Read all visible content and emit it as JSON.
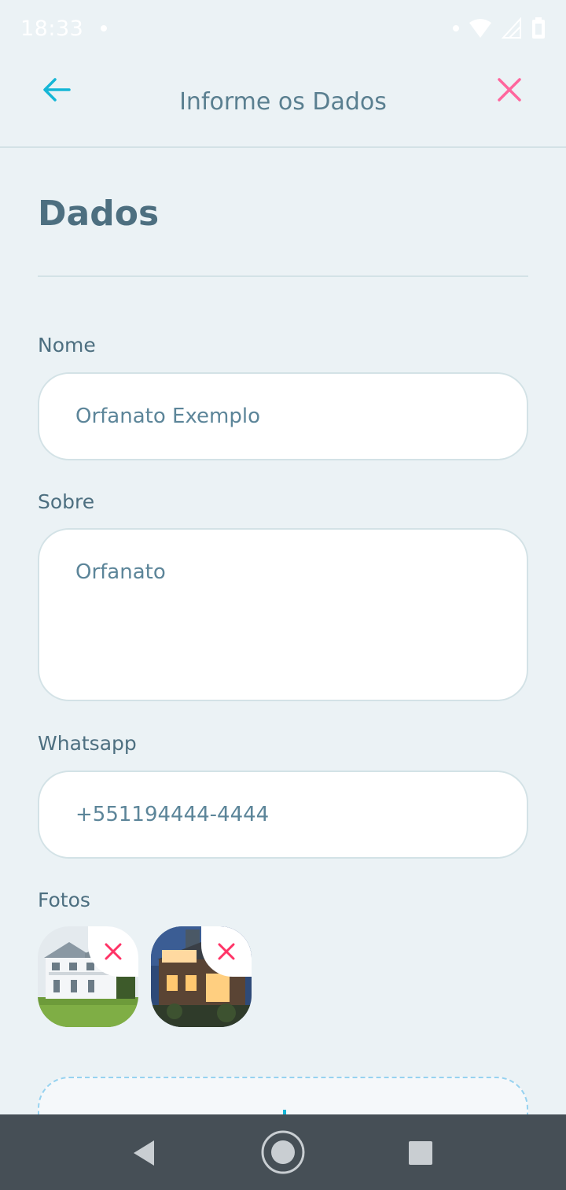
{
  "status_bar": {
    "time": "18:33"
  },
  "header": {
    "title": "Informe os Dados"
  },
  "section": {
    "title": "Dados"
  },
  "form": {
    "name_label": "Nome",
    "name_value": "Orfanato Exemplo",
    "about_label": "Sobre",
    "about_value": "Orfanato",
    "whatsapp_label": "Whatsapp",
    "whatsapp_value": "+551194444-4444",
    "photos_label": "Fotos"
  },
  "colors": {
    "background": "#ebf2f5",
    "text": "#4d6f80",
    "accent_blue": "#15b6d6",
    "accent_pink": "#ff669d",
    "remove_red": "#ff3366",
    "nav_bar": "#464f56"
  },
  "icons": {
    "back": "arrow-left-icon",
    "close": "close-icon",
    "photo_remove": "close-icon",
    "nav_back": "triangle-back-icon",
    "nav_home": "circle-home-icon",
    "nav_recents": "square-recents-icon"
  }
}
